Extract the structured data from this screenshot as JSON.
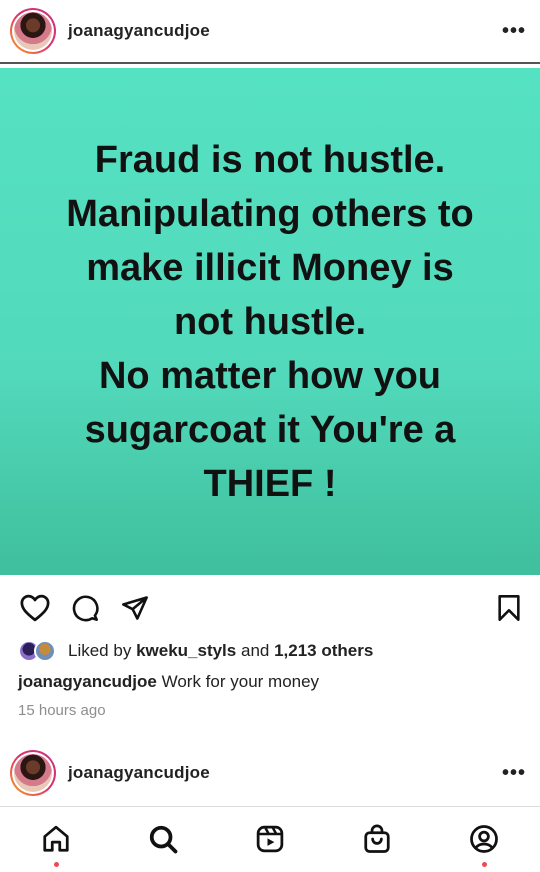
{
  "post": {
    "username": "joanagyancudjoe",
    "more_label": "•••",
    "image_text": [
      "Fraud is not hustle.",
      "Manipulating others to",
      "make illicit Money is",
      "not hustle.",
      "No matter how you",
      "sugarcoat it You're a",
      "THIEF !"
    ],
    "likes": {
      "prefix": "Liked by ",
      "user": "kweku_styls",
      "middle": " and ",
      "count": "1,213 others"
    },
    "caption": {
      "username": "joanagyancudjoe",
      "text": " Work for your money"
    },
    "time": "15 hours ago"
  },
  "next_post": {
    "username": "joanagyancudjoe",
    "more_label": "•••"
  },
  "colors": {
    "image_bg": "#55e2c2",
    "notification_dot": "#ed4956"
  }
}
